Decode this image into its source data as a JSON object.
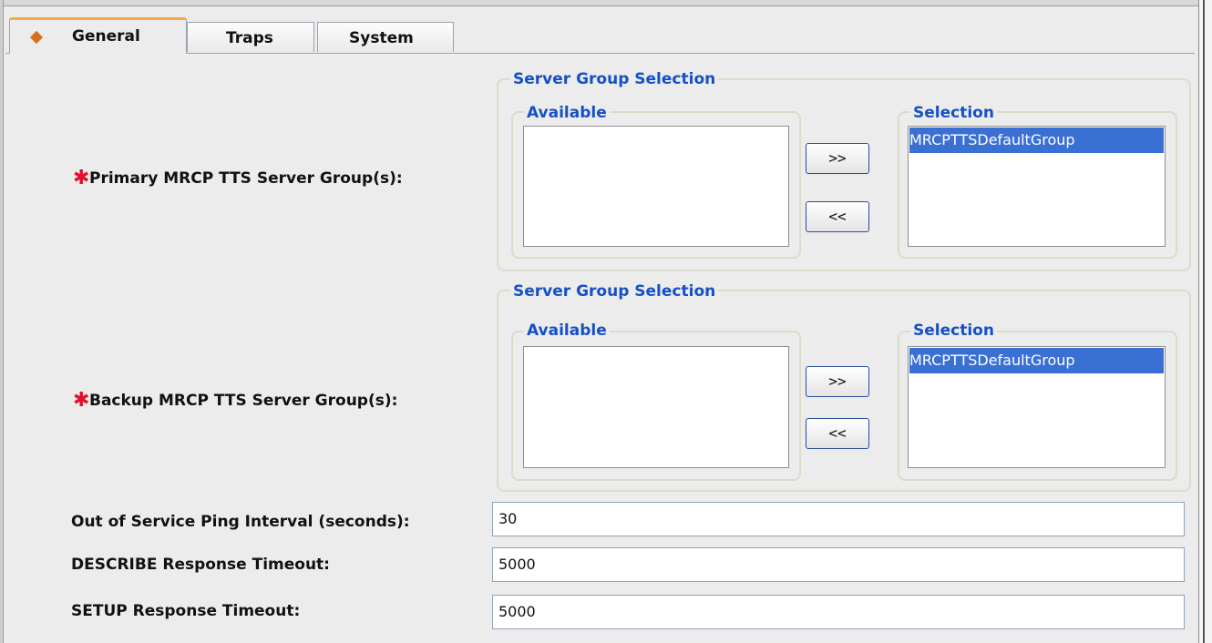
{
  "tabs": [
    {
      "label": "General",
      "active": true
    },
    {
      "label": "Traps",
      "active": false
    },
    {
      "label": "System",
      "active": false
    }
  ],
  "primary": {
    "label": "Primary MRCP TTS Server Group(s):",
    "required": true,
    "group_title": "Server Group Selection",
    "available_title": "Available",
    "available_items": [],
    "selection_title": "Selection",
    "selection_items": [
      "MRCPTTSDefaultGroup"
    ],
    "add_label": ">>",
    "remove_label": "<<"
  },
  "backup": {
    "label": "Backup MRCP TTS Server Group(s):",
    "required": true,
    "group_title": "Server Group Selection",
    "available_title": "Available",
    "available_items": [],
    "selection_title": "Selection",
    "selection_items": [
      "MRCPTTSDefaultGroup"
    ],
    "add_label": ">>",
    "remove_label": "<<"
  },
  "fields": [
    {
      "label": "Out of Service Ping Interval (seconds):",
      "value": "30"
    },
    {
      "label": "DESCRIBE Response Timeout:",
      "value": "5000"
    },
    {
      "label": "SETUP Response Timeout:",
      "value": "5000"
    }
  ],
  "colors": {
    "legend": "#1550c6",
    "selection_highlight": "#3a6fd4",
    "required_star": "#e0102f",
    "active_tab_accent": "#f7a844"
  },
  "icons": {
    "active_tab": "diamond-icon",
    "required": "asterisk-icon"
  }
}
